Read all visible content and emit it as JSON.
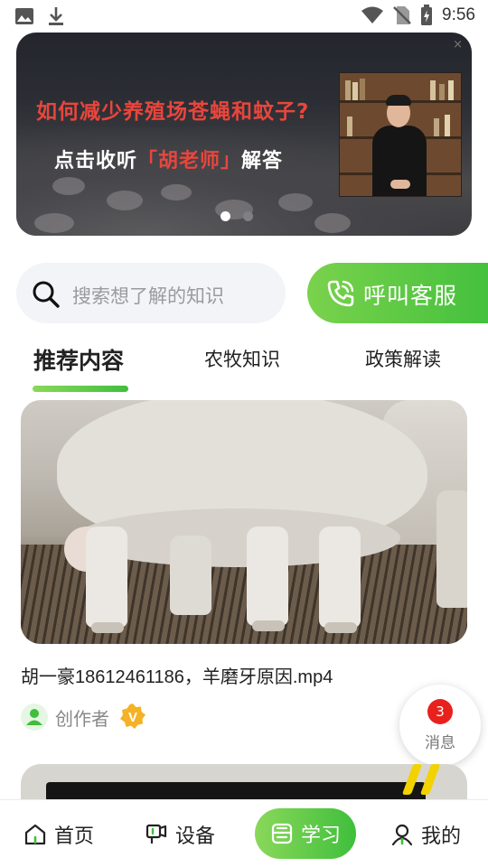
{
  "status_bar": {
    "time": "9:56"
  },
  "banner": {
    "title": "如何减少养殖场苍蝇和蚊子?",
    "subtitle_prefix": "点击收听",
    "subtitle_highlight": "「胡老师」",
    "subtitle_suffix": "解答",
    "close_glyph": "×",
    "dots_total": 2,
    "dots_active": 0
  },
  "search": {
    "placeholder": "搜索想了解的知识"
  },
  "call_button": {
    "label": "呼叫客服"
  },
  "tabs": [
    {
      "label": "推荐内容",
      "active": true
    },
    {
      "label": "农牧知识",
      "active": false
    },
    {
      "label": "政策解读",
      "active": false
    }
  ],
  "feed": [
    {
      "title": "胡一豪18612461186，羊磨牙原因.mp4",
      "author": "创作者",
      "badge": "V"
    }
  ],
  "messages": {
    "count": "3",
    "label": "消息"
  },
  "bottom_nav": {
    "home": "首页",
    "devices": "设备",
    "learn": "学习",
    "mine": "我的"
  },
  "colors": {
    "accent_green": "#3fbf3c",
    "accent_light_green": "#8ad85a",
    "banner_red": "#e8463c",
    "badge_red": "#e8211d"
  }
}
